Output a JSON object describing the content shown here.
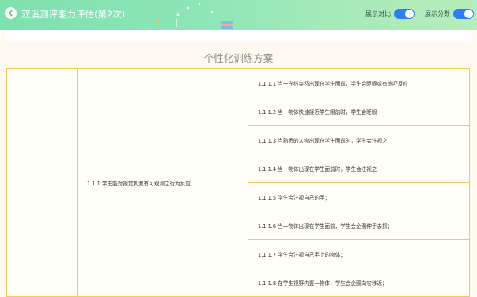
{
  "header": {
    "title": "双溪测评能力评估(第2次)",
    "toggles": [
      {
        "label": "展示对比",
        "on": true
      },
      {
        "label": "展示分数",
        "on": true
      }
    ]
  },
  "colors": {
    "header_start": "#7fe0b0",
    "header_end": "#b6edba",
    "toggle_on": "#2f7df6",
    "table_border": "#f2cc55",
    "page_bg": "#fefaf0"
  },
  "section_title": "个性化训练方案",
  "plan": {
    "category": "",
    "goal": "1.1.1 学生能对视觉刺激有可观测之行为反应",
    "items": [
      "1.1.1.1 当一光线突然出现在学生面前，学生会眨眼或有惊吓反应",
      "1.1.1.2 当一物体快速接近学生眼前时，学生会眨眼",
      "1.1.1.3 当熟悉的人物出现在学生面前时，学生会注视之",
      "1.1.1.4 当一物体出现在学生面前时，学生会注视之",
      "1.1.1.5 学生会注视自己的手；",
      "1.1.1.6 当一物体出现在学生面前，学生会企图伸手去抓；",
      "1.1.1.7 学生会注视自己手上的物体；",
      "1.1.1.8 在学生视野内置一物体，学生会企图向它移近；"
    ]
  }
}
